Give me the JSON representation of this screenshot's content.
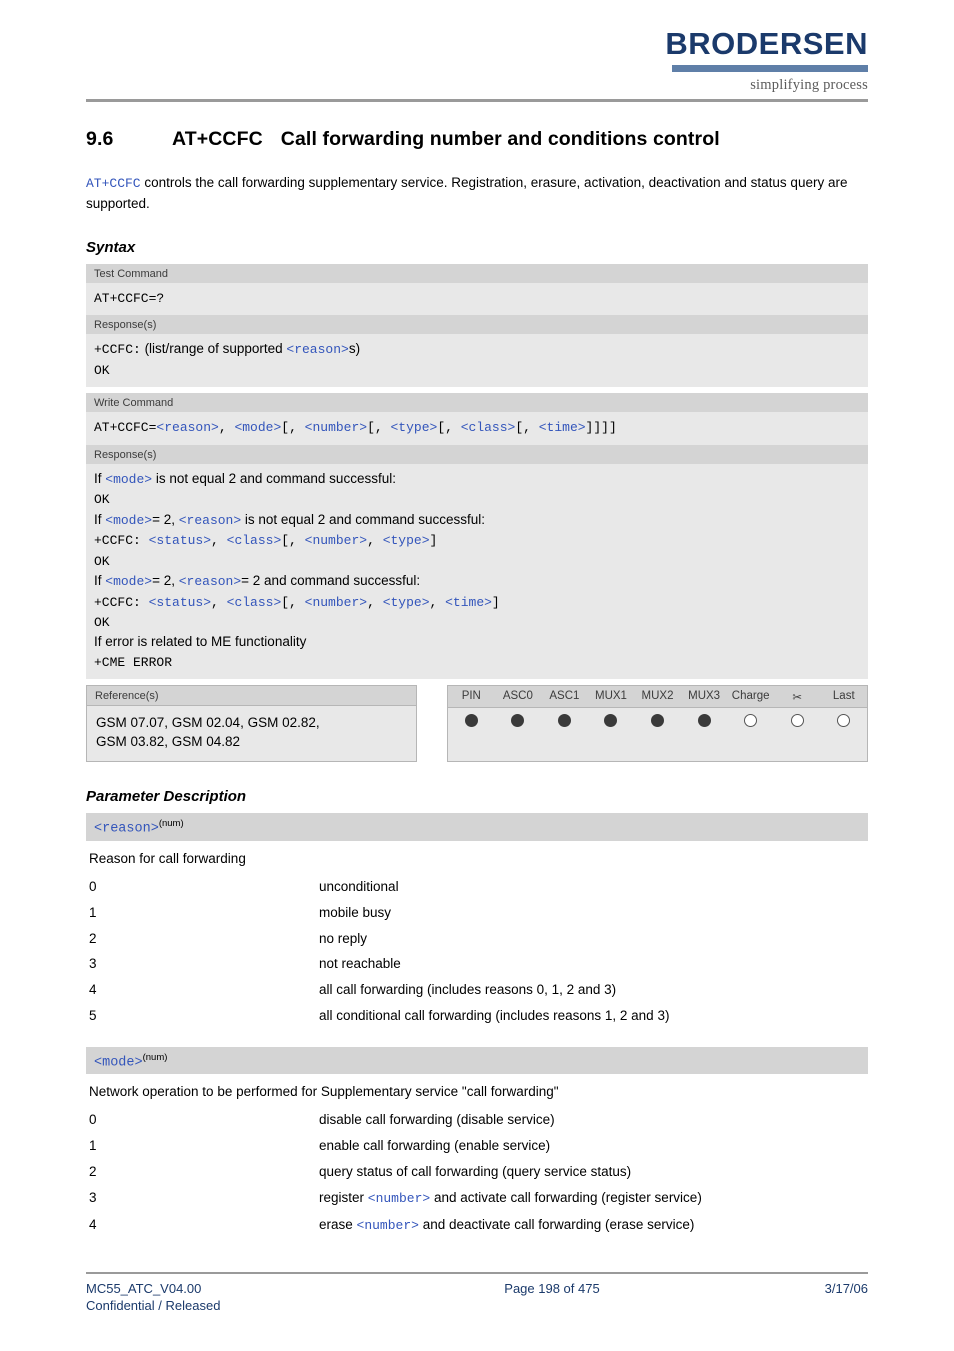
{
  "header": {
    "brand": "BRODERSEN",
    "tagline": "simplifying process"
  },
  "section": {
    "number": "9.6",
    "command": "AT+CCFC",
    "title": "Call forwarding number and conditions control",
    "intro_cmd": "AT+CCFC",
    "intro_text": " controls the call forwarding supplementary service. Registration, erasure, activation, deactivation and status query are supported."
  },
  "syntax": {
    "heading": "Syntax",
    "test_label": "Test Command",
    "test_command": "AT+CCFC=?",
    "test_response_label": "Response(s)",
    "test_response_1_cmd": "+CCFC:",
    "test_response_1_text": " (list/range of supported ",
    "test_response_1_param": "<reason>",
    "test_response_1_tail": "s)",
    "test_response_ok": "OK",
    "write_label": "Write Command",
    "write_command_prefix": "AT+CCFC=",
    "write_command_params": "<reason>, <mode>[, <number>[, <type>[, <class>[, <time>]]]]",
    "write_response_label": "Response(s)",
    "write_lines": [
      "If <mode> is not equal 2 and command successful:",
      "OK",
      "If <mode>= 2, <reason> is not equal 2 and command successful:",
      "+CCFC: <status>, <class>[, <number>, <type>]",
      "OK",
      "If <mode>= 2, <reason>= 2 and command successful:",
      "+CCFC: <status>, <class>[, <number>, <type>, <time>]",
      "OK",
      "If error is related to ME functionality",
      "+CME ERROR"
    ],
    "reference_label": "Reference(s)",
    "reference_line1": "GSM 07.07, GSM 02.04, GSM 02.82,",
    "reference_line2": "GSM 03.82, GSM 04.82",
    "support_columns": [
      "PIN",
      "ASC0",
      "ASC1",
      "MUX1",
      "MUX2",
      "MUX3",
      "Charge",
      "✂",
      "Last"
    ],
    "support_values": [
      "filled",
      "filled",
      "filled",
      "filled",
      "filled",
      "filled",
      "empty",
      "empty",
      "empty"
    ]
  },
  "parameters": {
    "heading": "Parameter Description",
    "items": [
      {
        "name": "<reason>",
        "type": "(num)",
        "description": "Reason for call forwarding",
        "rows": [
          {
            "key": "0",
            "val": "unconditional"
          },
          {
            "key": "1",
            "val": "mobile busy"
          },
          {
            "key": "2",
            "val": "no reply"
          },
          {
            "key": "3",
            "val": "not reachable"
          },
          {
            "key": "4",
            "val": "all call forwarding (includes reasons 0, 1, 2 and 3)"
          },
          {
            "key": "5",
            "val": "all conditional call forwarding (includes reasons 1, 2 and 3)"
          }
        ]
      },
      {
        "name": "<mode>",
        "type": "(num)",
        "description": "Network operation to be performed for Supplementary service \"call forwarding\"",
        "rows": [
          {
            "key": "0",
            "val": "disable call forwarding (disable service)"
          },
          {
            "key": "1",
            "val": "enable call forwarding (enable service)"
          },
          {
            "key": "2",
            "val": "query status of call forwarding (query service status)"
          },
          {
            "key": "3",
            "val": "register <number> and activate call forwarding (register service)",
            "mono_word": "<number>"
          },
          {
            "key": "4",
            "val": "erase <number> and deactivate call forwarding (erase service)",
            "mono_word": "<number>"
          }
        ]
      }
    ]
  },
  "footer": {
    "doc_id": "MC55_ATC_V04.00",
    "page": "Page 198 of 475",
    "date": "3/17/06",
    "status": "Confidential / Released"
  }
}
